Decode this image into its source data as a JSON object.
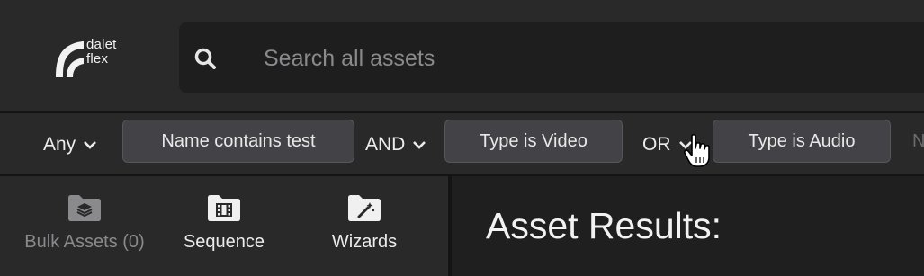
{
  "brand": {
    "line1": "dalet",
    "line2": "flex"
  },
  "search": {
    "placeholder": "Search all assets",
    "value": ""
  },
  "filters": {
    "match_mode": "Any",
    "conditions": [
      {
        "label": "Name contains test"
      },
      {
        "operator": "AND",
        "label": "Type is Video"
      },
      {
        "operator": "OR",
        "label": "Type is Audio"
      }
    ],
    "overflow_text": "N"
  },
  "toolbar": {
    "items": [
      {
        "label": "Bulk Assets (0)",
        "icon": "layers-folder-icon",
        "enabled": false
      },
      {
        "label": "Sequence",
        "icon": "film-folder-icon",
        "enabled": true
      },
      {
        "label": "Wizards",
        "icon": "wand-folder-icon",
        "enabled": true
      }
    ]
  },
  "results": {
    "title": "Asset Results:"
  },
  "colors": {
    "background": "#1e1e1f",
    "panel": "#29292a",
    "chip": "#434347",
    "text": "#ececec",
    "placeholder": "#8a8a8c"
  }
}
